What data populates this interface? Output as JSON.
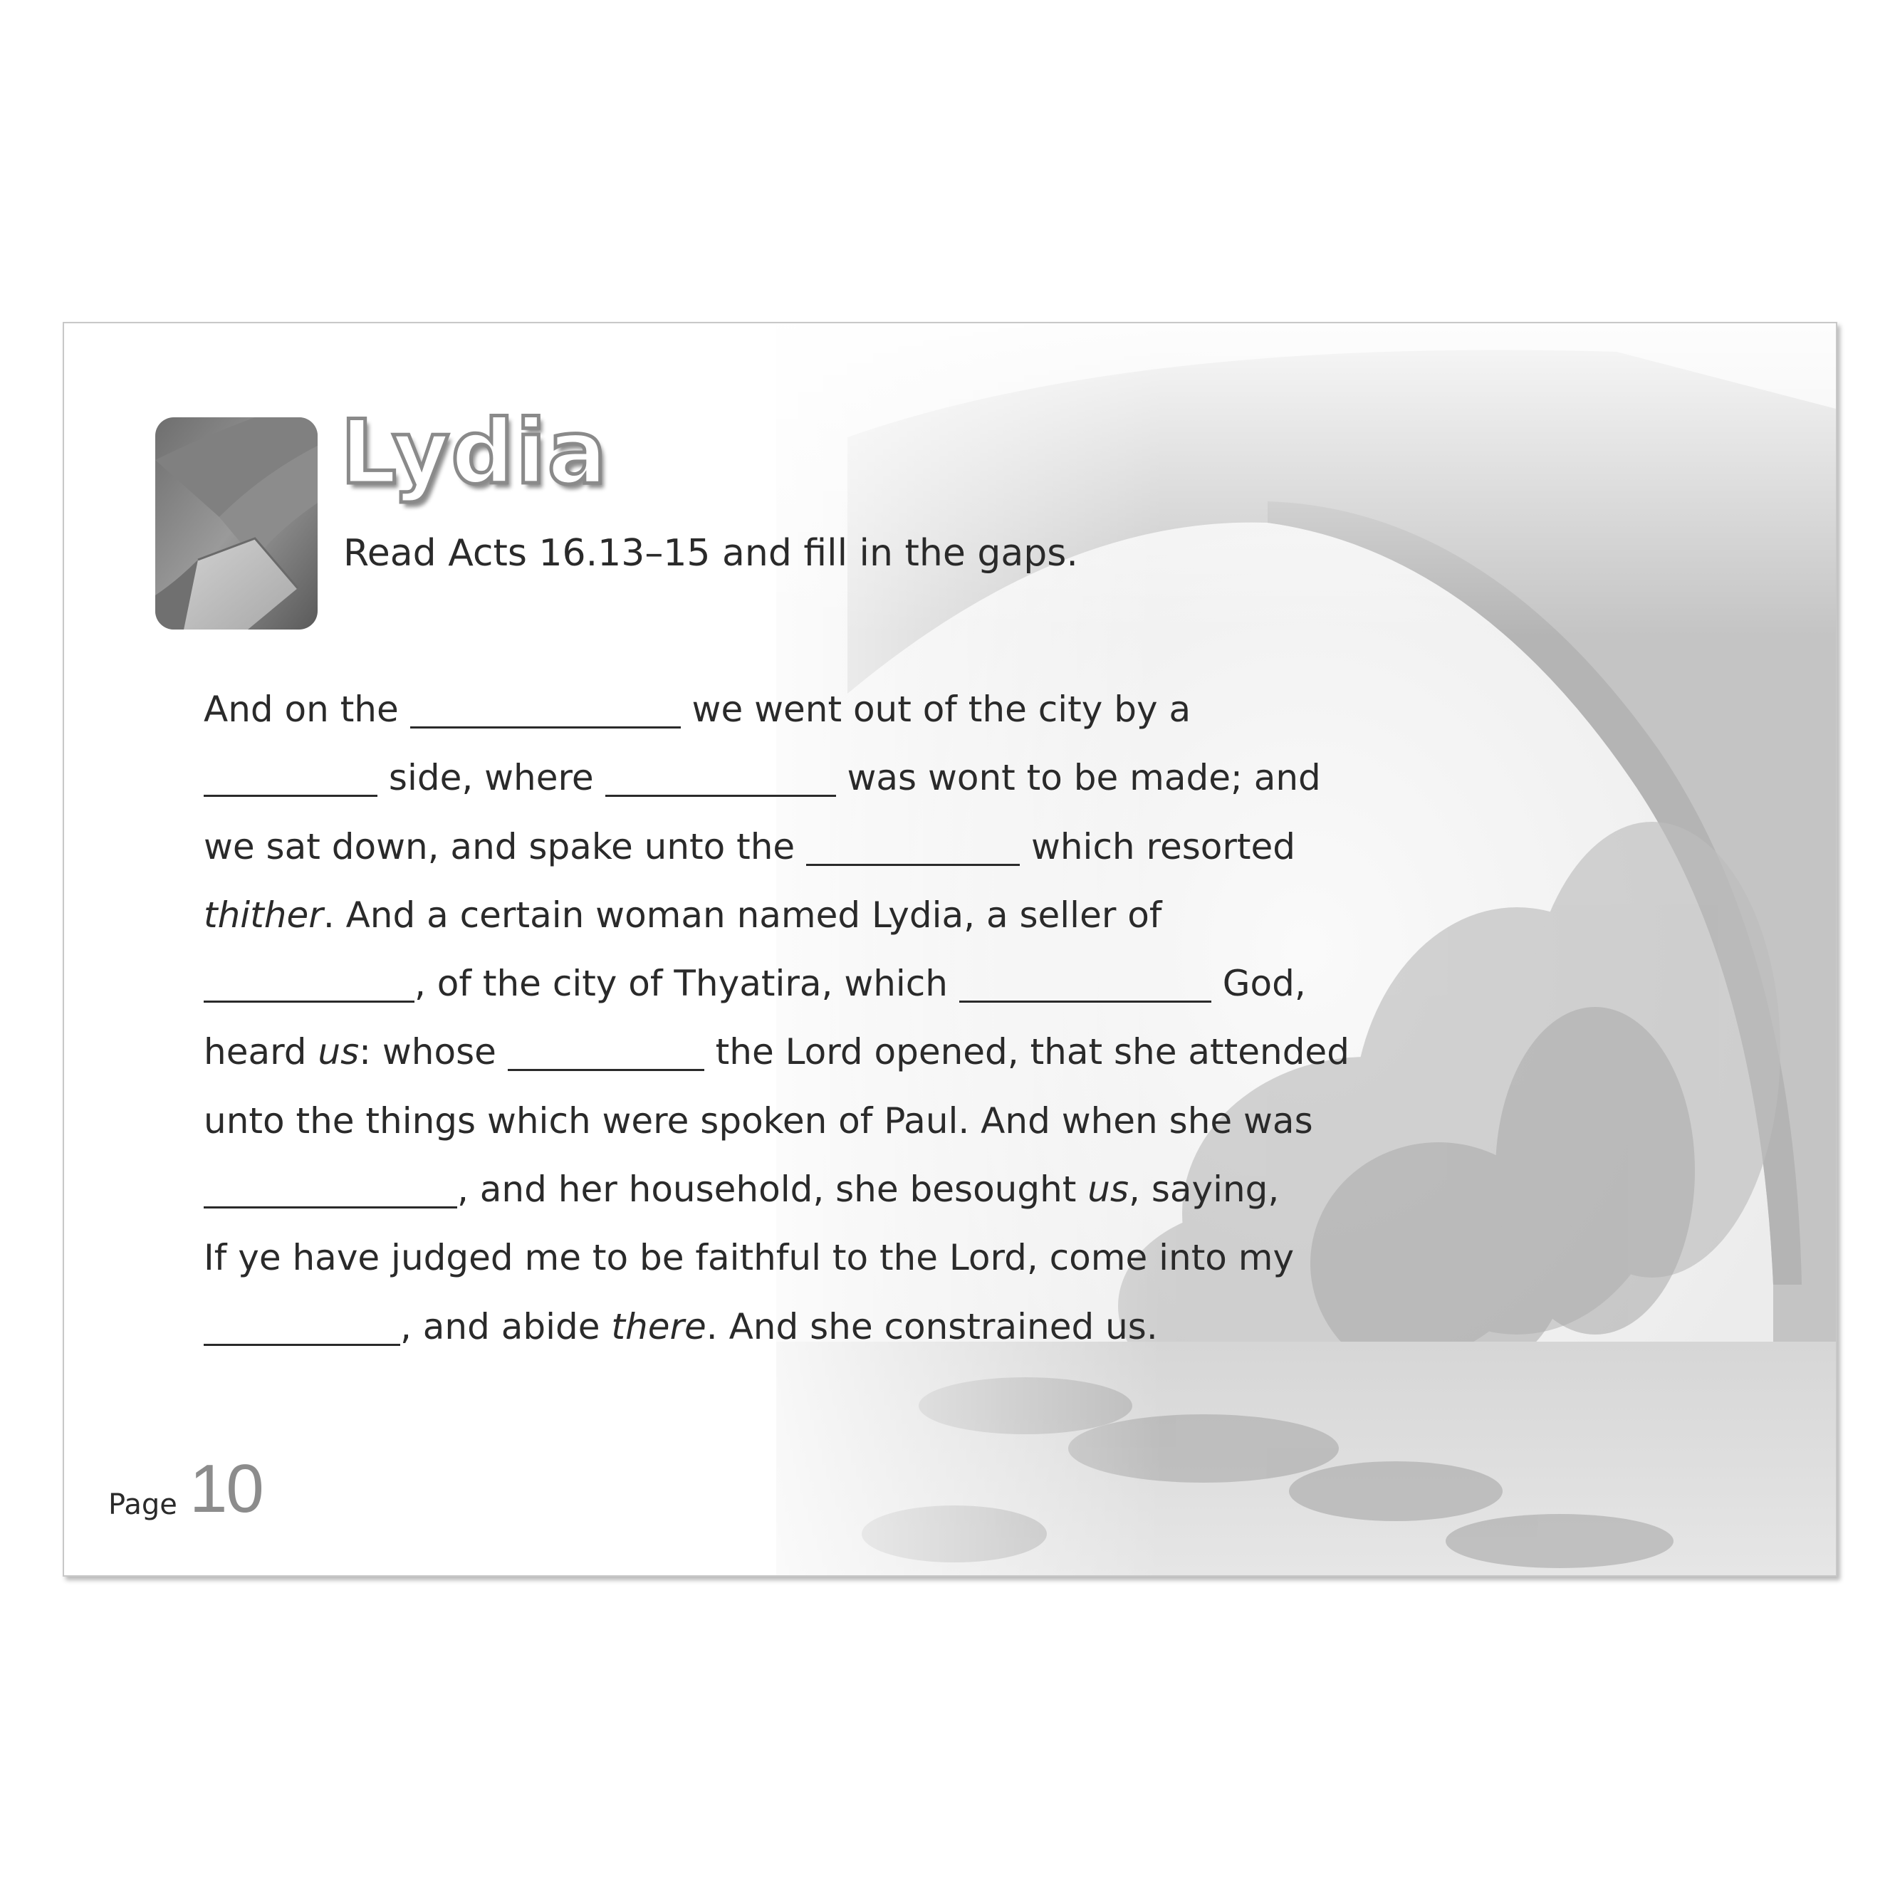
{
  "title": "Lydia",
  "instruction": "Read Acts 16.13–15 and fill in the gaps.",
  "passage": {
    "l1a": "And on the ",
    "l1b": " we went out of the city by a",
    "l2a": " side, where ",
    "l2b": " was wont to be made; and",
    "l3a": "we sat down, and spake unto the ",
    "l3b": " which resorted",
    "l4a": "thither",
    "l4b": ". And a certain woman named Lydia, a seller of",
    "l5a": ", of the city of Thyatira, which ",
    "l5b": " God,",
    "l6a": "heard ",
    "l6b": "us",
    "l6c": ": whose ",
    "l6d": " the Lord opened, that she attended",
    "l7": "unto the things which were spoken of Paul. And when she was",
    "l8a": ", and her household, she besought ",
    "l8b": "us",
    "l8c": ", saying,",
    "l9": "If ye have judged me to be faithful to the Lord, come into my",
    "l10a": ", and abide ",
    "l10b": "there",
    "l10c": ". And she constrained us."
  },
  "footer": {
    "page_label": "Page",
    "page_number": "10"
  },
  "colors": {
    "text": "#2a2a2a",
    "title_outline": "#8a8a8a",
    "page_number": "#8c8c8c",
    "card_border": "#c8c8c8"
  },
  "icons": {
    "header_image": "folded-fabric-icon",
    "background": "stone-bridge-river-photo"
  }
}
